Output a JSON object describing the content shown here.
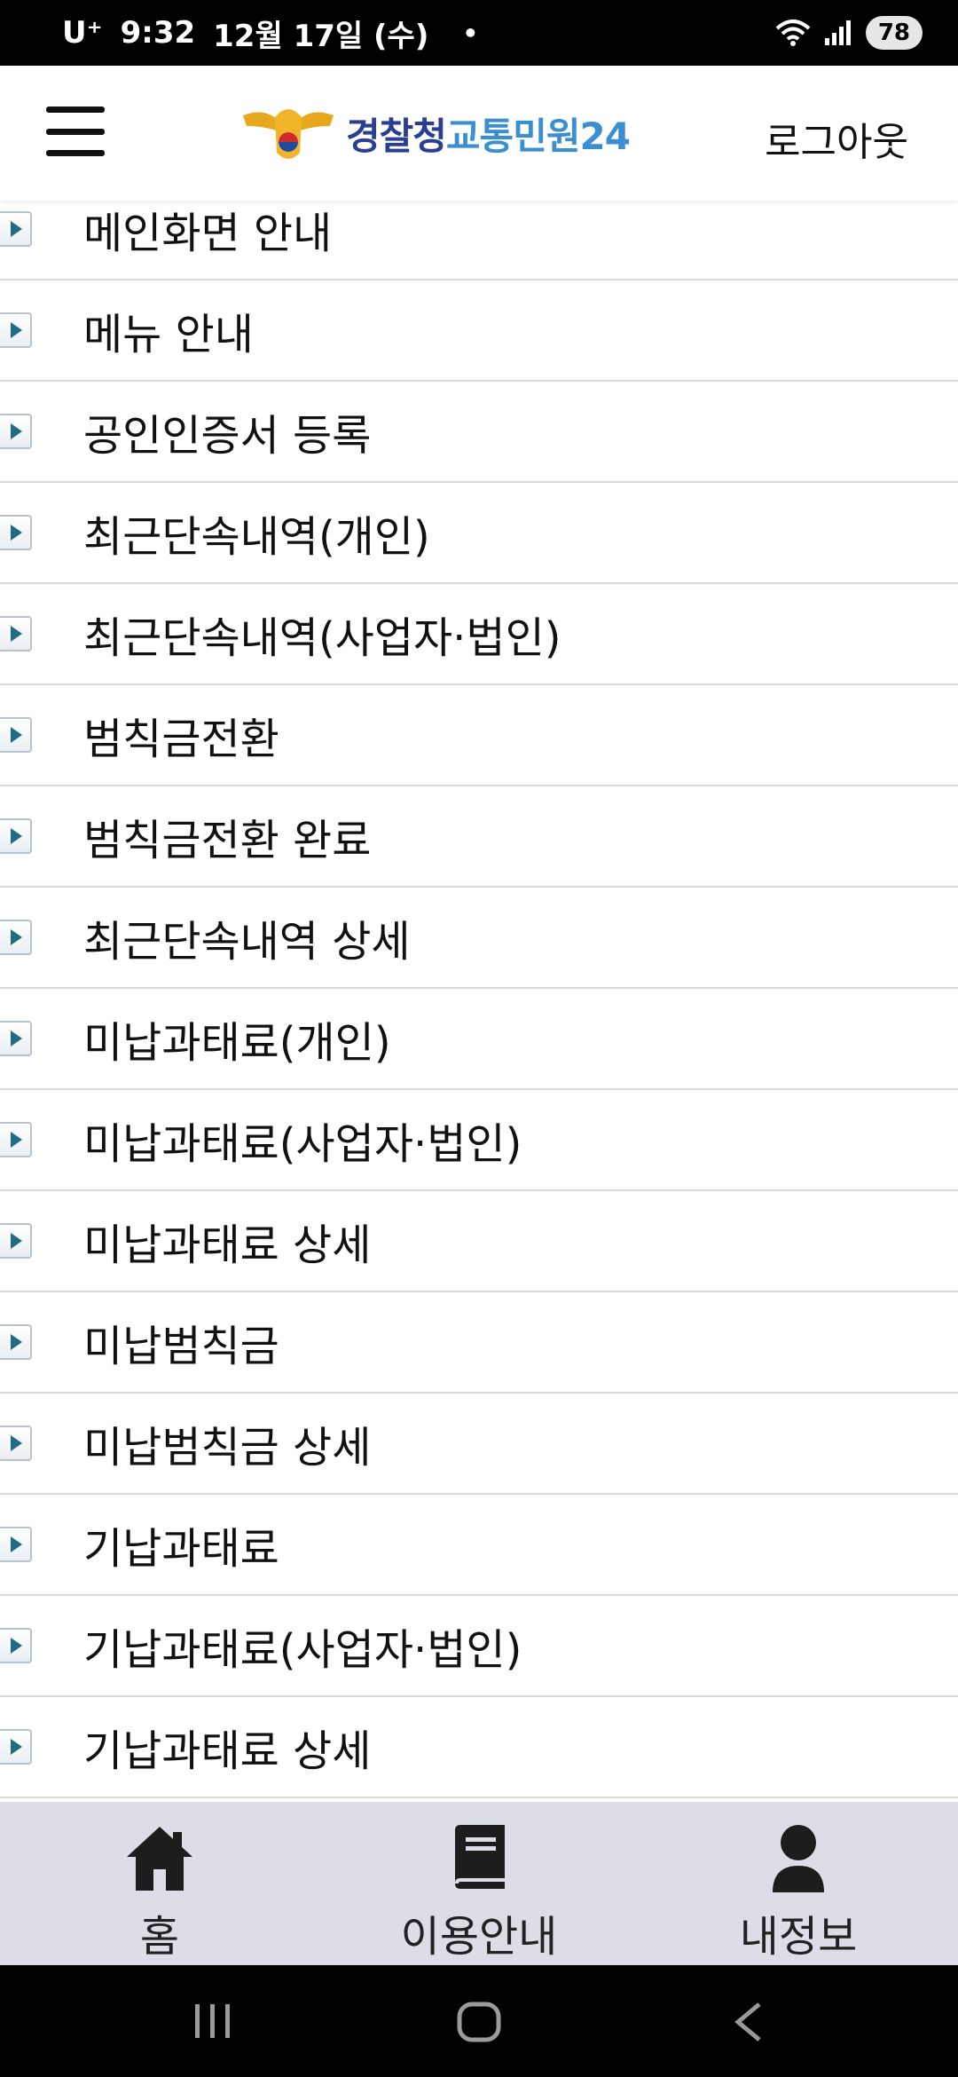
{
  "status_bar": {
    "carrier": "U⁺",
    "time": "9:32",
    "date": "12월 17일 (수)",
    "dot": "•",
    "battery": "78"
  },
  "header": {
    "logo_part1": "경찰청",
    "logo_part2": "교통민원24",
    "logout_label": "로그아웃",
    "menu_icon": "hamburger-menu-icon"
  },
  "menu_list": {
    "items": [
      {
        "label": "메인화면 안내"
      },
      {
        "label": "메뉴 안내"
      },
      {
        "label": "공인인증서 등록"
      },
      {
        "label": "최근단속내역(개인)"
      },
      {
        "label": "최근단속내역(사업자·법인)"
      },
      {
        "label": "범칙금전환"
      },
      {
        "label": "범칙금전환 완료"
      },
      {
        "label": "최근단속내역 상세"
      },
      {
        "label": "미납과태료(개인)"
      },
      {
        "label": "미납과태료(사업자·법인)"
      },
      {
        "label": "미납과태료 상세"
      },
      {
        "label": "미납범칙금"
      },
      {
        "label": "미납범칙금 상세"
      },
      {
        "label": "기납과태료"
      },
      {
        "label": "기납과태료(사업자·법인)"
      },
      {
        "label": "기납과태료 상세"
      }
    ]
  },
  "tabbar": {
    "tabs": [
      {
        "label": "홈",
        "icon": "home-icon"
      },
      {
        "label": "이용안내",
        "icon": "book-icon"
      },
      {
        "label": "내정보",
        "icon": "person-icon"
      }
    ]
  },
  "colors": {
    "accent_dark": "#2a3f8f",
    "accent_light": "#3b8fd1",
    "arrow": "#236a86",
    "tabbar_bg": "#dcdde6"
  }
}
